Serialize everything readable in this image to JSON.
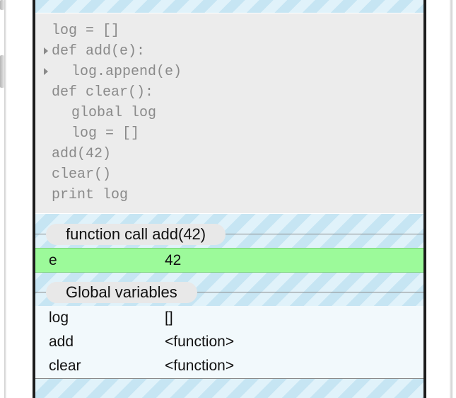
{
  "code_editor": {
    "lines": [
      {
        "text": "log = []",
        "indent": false,
        "fold": false
      },
      {
        "text": "def add(e):",
        "indent": false,
        "fold": true
      },
      {
        "text": "log.append(e)",
        "indent": true,
        "fold": true
      },
      {
        "text": "def clear():",
        "indent": false,
        "fold": false
      },
      {
        "text": "global log",
        "indent": true,
        "fold": false
      },
      {
        "text": "log = []",
        "indent": true,
        "fold": false
      },
      {
        "text": "add(42)",
        "indent": false,
        "fold": false
      },
      {
        "text": "clear()",
        "indent": false,
        "fold": false
      },
      {
        "text": "print log",
        "indent": false,
        "fold": false
      }
    ]
  },
  "call_frame": {
    "title": "function call add(42)",
    "variables": [
      {
        "name": "e",
        "value": "42"
      }
    ],
    "highlight_color": "#9cfa9a"
  },
  "global_frame": {
    "title": "Global variables",
    "variables": [
      {
        "name": "log",
        "value": "[]"
      },
      {
        "name": "add",
        "value": "<function>"
      },
      {
        "name": "clear",
        "value": "<function>"
      }
    ]
  }
}
